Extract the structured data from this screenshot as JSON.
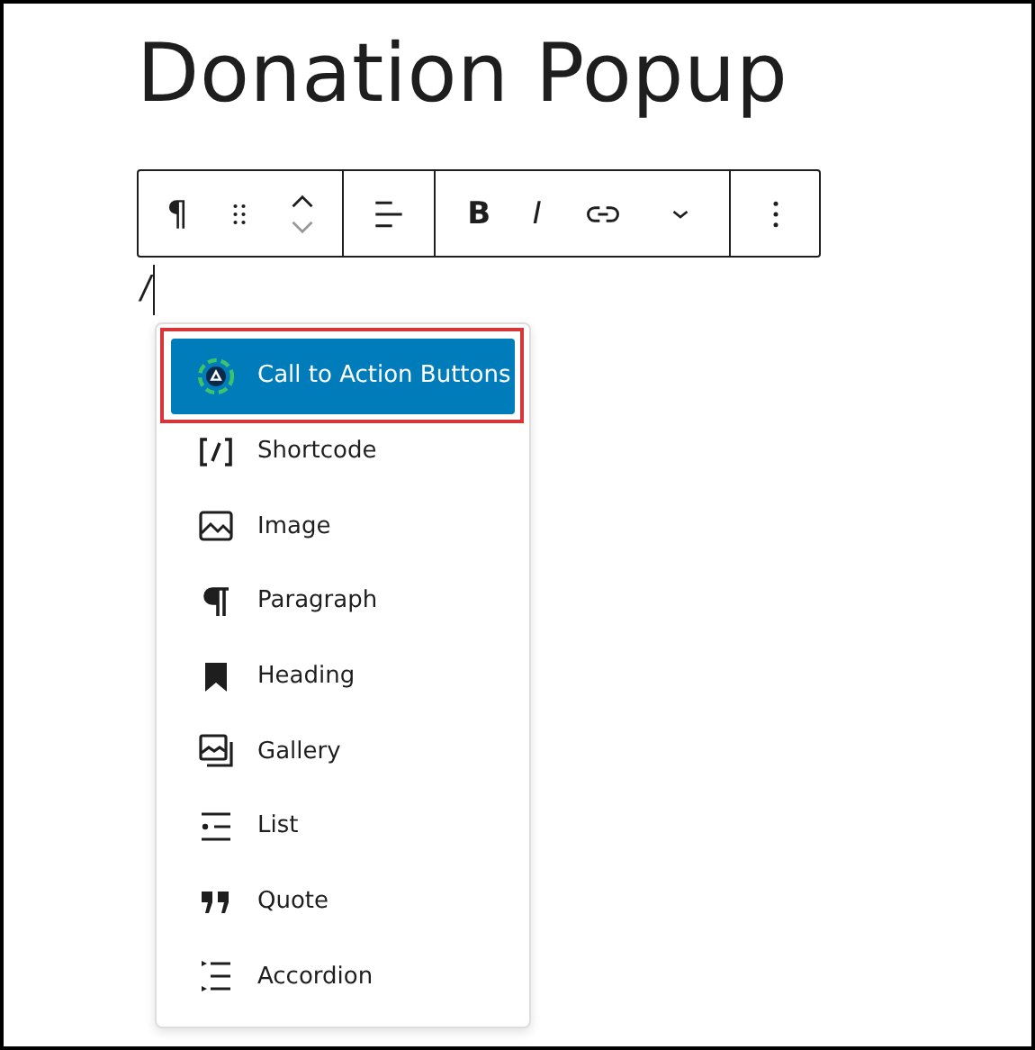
{
  "title": "Donation Popup",
  "toolbar": {
    "groups": [
      {
        "tools": [
          {
            "kind": "pilcrow",
            "label": "¶"
          },
          {
            "kind": "drag"
          },
          {
            "kind": "move"
          }
        ]
      },
      {
        "tools": [
          {
            "kind": "align"
          }
        ]
      },
      {
        "tools": [
          {
            "kind": "bold",
            "label": "B"
          },
          {
            "kind": "italic",
            "label": "I"
          },
          {
            "kind": "link"
          },
          {
            "kind": "more"
          }
        ]
      },
      {
        "tools": [
          {
            "kind": "options"
          }
        ]
      }
    ]
  },
  "editor": {
    "typed": "/"
  },
  "inserter": {
    "items": [
      {
        "label": "Call to Action Buttons",
        "selected": true,
        "callout": true
      },
      {
        "label": "Shortcode",
        "selected": false,
        "callout": false
      },
      {
        "label": "Image",
        "selected": false,
        "callout": false
      },
      {
        "label": "Paragraph",
        "selected": false,
        "callout": false
      },
      {
        "label": "Heading",
        "selected": false,
        "callout": false
      },
      {
        "label": "Gallery",
        "selected": false,
        "callout": false
      },
      {
        "label": "List",
        "selected": false,
        "callout": false
      },
      {
        "label": "Quote",
        "selected": false,
        "callout": false
      },
      {
        "label": "Accordion",
        "selected": false,
        "callout": false
      }
    ]
  }
}
